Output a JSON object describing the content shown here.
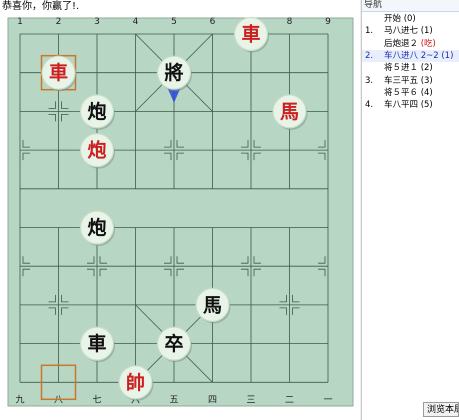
{
  "status_text": "恭喜你，你赢了!.",
  "board": {
    "top_files": [
      "1",
      "2",
      "3",
      "4",
      "5",
      "6",
      "7",
      "8",
      "9"
    ],
    "bottom_files": [
      "九",
      "八",
      "七",
      "六",
      "五",
      "四",
      "三",
      "二",
      "一"
    ],
    "highlighted_squares": [
      {
        "col": 1,
        "row": 1
      },
      {
        "col": 1,
        "row": 9
      }
    ],
    "last_move_arrow": {
      "col": 4,
      "from_row": 0,
      "to_row": 1
    },
    "pieces": [
      {
        "name": "black-chariot-top",
        "char": "車",
        "side": "red",
        "col": 6,
        "row": 0
      },
      {
        "name": "red-chariot-highlighted",
        "char": "車",
        "side": "red",
        "col": 1,
        "row": 1
      },
      {
        "name": "black-general",
        "char": "將",
        "side": "black",
        "col": 4,
        "row": 1
      },
      {
        "name": "black-cannon-upper",
        "char": "炮",
        "side": "black",
        "col": 2,
        "row": 2
      },
      {
        "name": "red-horse-upper",
        "char": "馬",
        "side": "red",
        "col": 7,
        "row": 2
      },
      {
        "name": "red-cannon",
        "char": "炮",
        "side": "red",
        "col": 2,
        "row": 3
      },
      {
        "name": "black-cannon-lower",
        "char": "炮",
        "side": "black",
        "col": 2,
        "row": 5
      },
      {
        "name": "black-horse",
        "char": "馬",
        "side": "black",
        "col": 5,
        "row": 7
      },
      {
        "name": "black-chariot-lower",
        "char": "車",
        "side": "black",
        "col": 2,
        "row": 8
      },
      {
        "name": "black-soldier",
        "char": "卒",
        "side": "black",
        "col": 4,
        "row": 8
      },
      {
        "name": "red-king",
        "char": "帥",
        "side": "red",
        "col": 3,
        "row": 9
      }
    ]
  },
  "side_panel": {
    "title": "导航",
    "moves": [
      {
        "num": "",
        "text": "开始 (0)",
        "tag": ""
      },
      {
        "num": "1.",
        "text": "马八进七 (1)",
        "tag": ""
      },
      {
        "num": "",
        "text": "后炮退２",
        "tag": "(吃)"
      },
      {
        "num": "2.",
        "text": "车八进八 2~2 (1)",
        "tag": "",
        "selected": true
      },
      {
        "num": "",
        "text": "将５进１ (2)",
        "tag": ""
      },
      {
        "num": "3.",
        "text": "车三平五 (3)",
        "tag": ""
      },
      {
        "num": "",
        "text": "将５平６ (4)",
        "tag": ""
      },
      {
        "num": "4.",
        "text": "车八平四 (5)",
        "tag": ""
      }
    ],
    "browse_button": "浏览本局"
  },
  "colors": {
    "board_bg": "#b8d6c4",
    "grid": "#3c5a48",
    "red_piece": "#cc1f1f",
    "black_piece": "#101010",
    "piece_face": "#e8f4e8",
    "highlight": "#c9782b",
    "arrow": "#2747d9"
  }
}
